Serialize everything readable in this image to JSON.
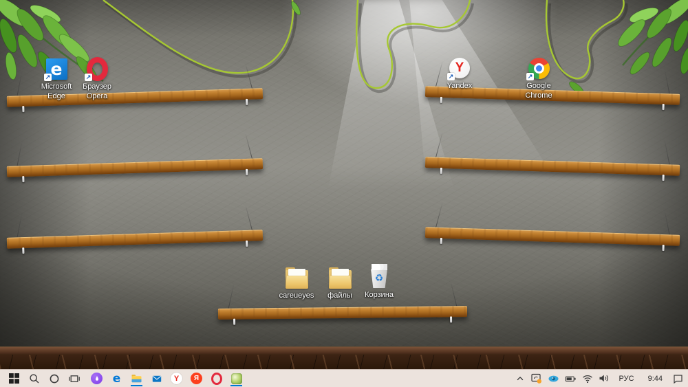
{
  "desktop_icons": {
    "edge": {
      "line1": "Microsoft",
      "line2": "Edge",
      "glyph": "e"
    },
    "opera": {
      "line1": "Браузер",
      "line2": "Opera"
    },
    "yandex": {
      "line1": "Yandex",
      "glyph": "Y"
    },
    "chrome": {
      "line1": "Google",
      "line2": "Chrome"
    },
    "careueyes": {
      "label": "careueyes"
    },
    "files": {
      "label": "файлы"
    },
    "recycle_bin": {
      "label": "Корзина",
      "glyph": "♻"
    },
    "shortcut_arrow_glyph": "↗"
  },
  "taskbar": {
    "icon_names": [
      "start",
      "search",
      "cortana",
      "task-view",
      "yandex-alice",
      "edge",
      "file-explorer",
      "mail",
      "yandex-browser",
      "yandex",
      "opera",
      "careueyes-app"
    ],
    "active_items": [
      "file-explorer",
      "careueyes-app"
    ],
    "glyphs": {
      "edge": "e",
      "yandex_browser": "Y",
      "yandex": "Я"
    },
    "tray": {
      "icon_names": [
        "hidden-icons-chevron",
        "screen-app-orange-badge",
        "careueyes-eye",
        "battery",
        "wifi",
        "volume",
        "action-center"
      ],
      "language": "РУС",
      "time": "9:44"
    }
  },
  "colors": {
    "accent": "#0078d7",
    "taskbar_bg": "#ece3dd",
    "shelf_wood": "#b5722a",
    "wall_gray": "#8b8a83",
    "leaf_green": "#6ab33a",
    "opera_red": "#e3293d",
    "yandex_red": "#fc3f1d",
    "edge_blue": "#0c6fc4",
    "alice_purple": "#7d3be8",
    "eye_blue": "#35a7dc",
    "badge_orange": "#f7a32a"
  }
}
